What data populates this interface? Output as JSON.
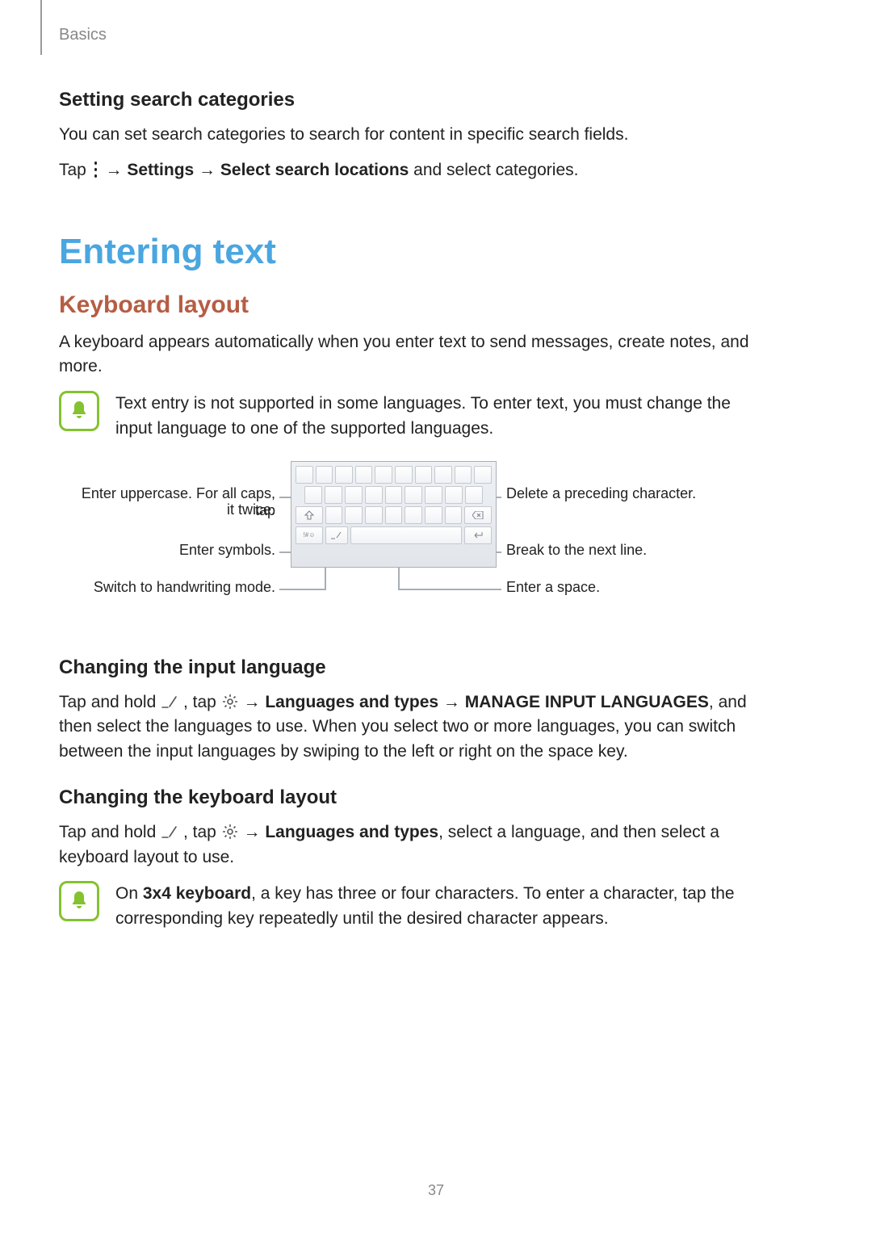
{
  "breadcrumb": "Basics",
  "page_number": "37",
  "s1": {
    "heading": "Setting search categories",
    "p1": "You can set search categories to search for content in specific search fields.",
    "p2_a": "Tap ",
    "p2_b": " → ",
    "p2_settings": "Settings",
    "p2_arrow": " → ",
    "p2_select": "Select search locations",
    "p2_c": " and select categories."
  },
  "h1": "Entering text",
  "h2": "Keyboard layout",
  "p_keyboard": "A keyboard appears automatically when you enter text to send messages, create notes, and more.",
  "note1": "Text entry is not supported in some languages. To enter text, you must change the input language to one of the supported languages.",
  "callouts": {
    "caps_a": "Enter uppercase. For all caps, tap",
    "caps_b": "it twice.",
    "symbols": "Enter symbols.",
    "handwriting": "Switch to handwriting mode.",
    "delete": "Delete a preceding character.",
    "newline": "Break to the next line.",
    "space": "Enter a space."
  },
  "s3": {
    "heading": "Changing the input language",
    "p_a": "Tap and hold ",
    "p_b": ", tap ",
    "p_c": " → ",
    "p_lang": "Languages and types",
    "p_d": " → ",
    "p_manage": "MANAGE INPUT LANGUAGES",
    "p_e": ", and then select the languages to use. When you select two or more languages, you can switch between the input languages by swiping to the left or right on the space key."
  },
  "s4": {
    "heading": "Changing the keyboard layout",
    "p_a": "Tap and hold ",
    "p_b": ", tap ",
    "p_c": " → ",
    "p_lang": "Languages and types",
    "p_d": ", select a language, and then select a keyboard layout to use."
  },
  "note2_a": "On ",
  "note2_b": "3x4 keyboard",
  "note2_c": ", a key has three or four characters. To enter a character, tap the corresponding key repeatedly until the desired character appears."
}
